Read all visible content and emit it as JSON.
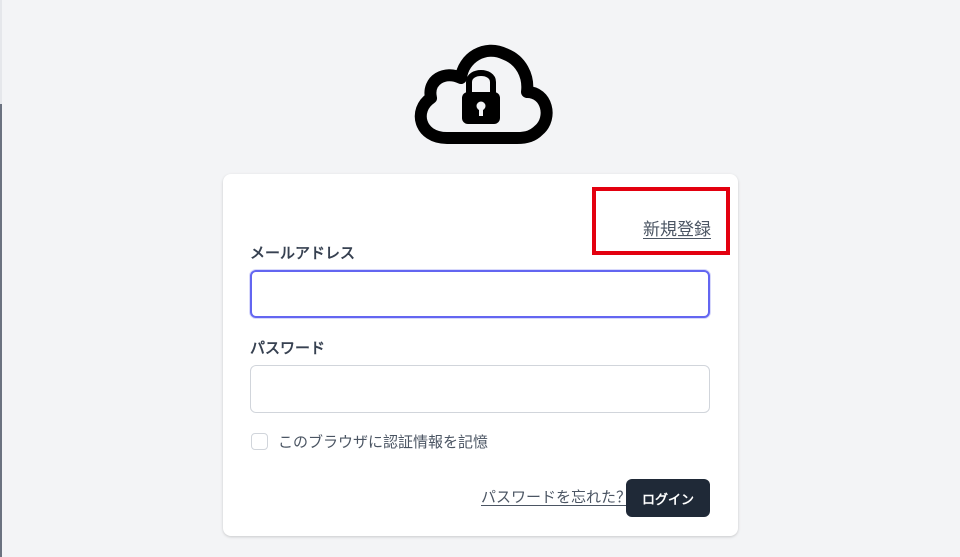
{
  "logo": {
    "icon": "cloud-lock-icon"
  },
  "register": {
    "link_label": "新規登録"
  },
  "form": {
    "email": {
      "label": "メールアドレス",
      "value": "",
      "placeholder": ""
    },
    "password": {
      "label": "パスワード",
      "value": "",
      "placeholder": ""
    },
    "remember": {
      "label": "このブラウザに認証情報を記憶",
      "checked": false
    },
    "forgot_link": "パスワードを忘れた？",
    "login_button": "ログイン"
  },
  "colors": {
    "background": "#f3f4f6",
    "card": "#ffffff",
    "focus_ring": "#6366f1",
    "button": "#1f2937",
    "highlight": "#e3000f"
  }
}
